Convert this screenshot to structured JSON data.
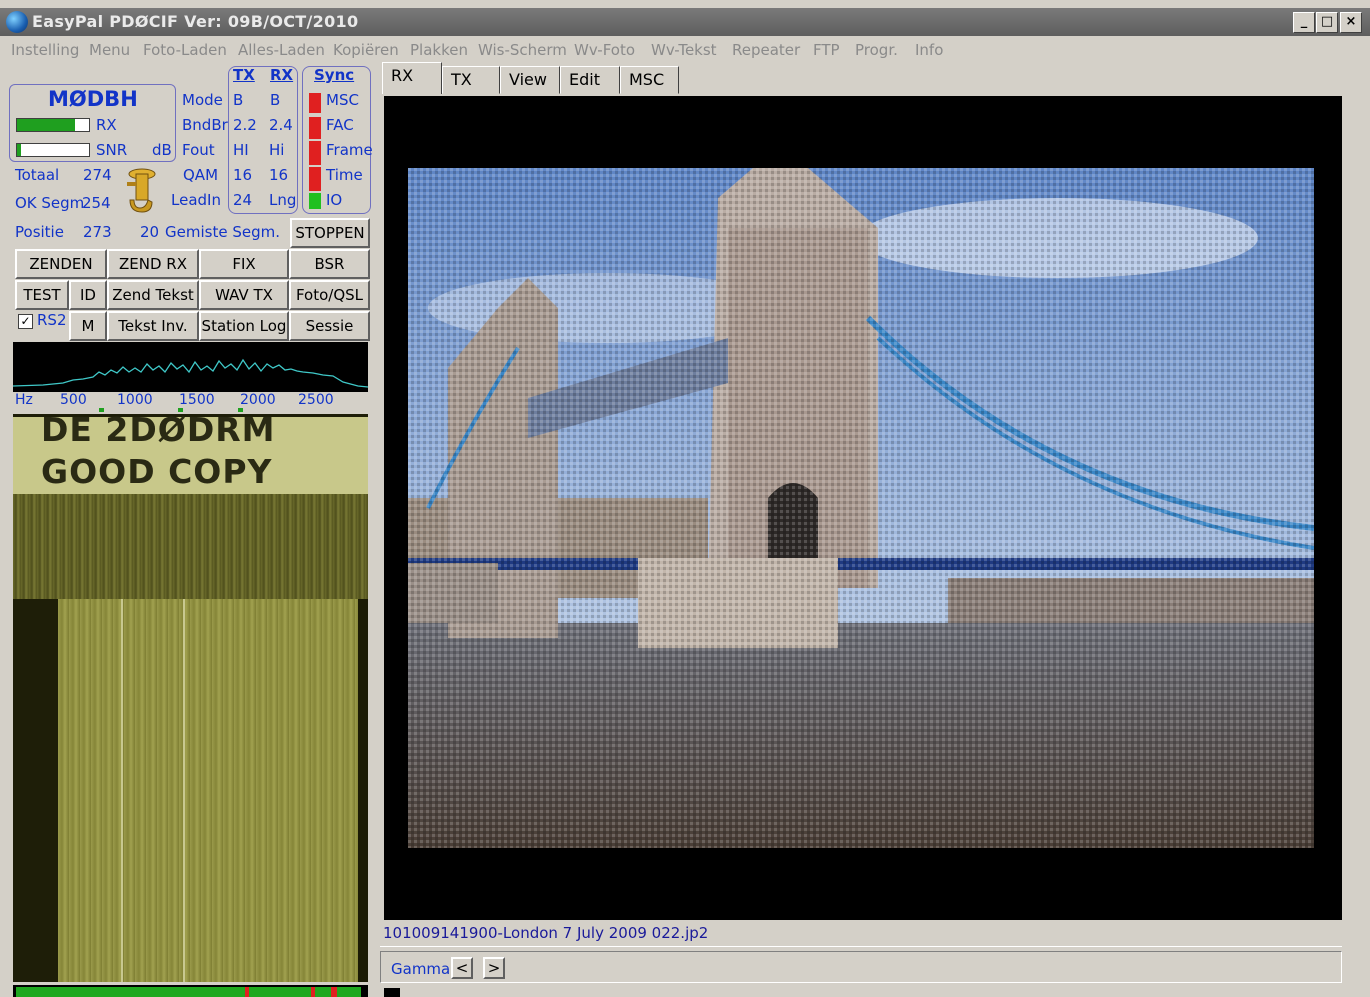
{
  "window": {
    "title": "EasyPal PDØCIF  Ver: 09B/OCT/2010"
  },
  "menu": [
    "Instelling",
    "Menu",
    "Foto-Laden",
    "Alles-Laden",
    "Kopiëren",
    "Plakken",
    "Wis-Scherm",
    "Wv-Foto",
    "Wv-Tekst",
    "Repeater",
    "FTP",
    "Progr.",
    "Info"
  ],
  "status": {
    "callsign": "MØDBH",
    "rx_label": "RX",
    "snr_label": "SNR",
    "db_label": "dB",
    "rx_level": 0.8,
    "snr_level": 0.06,
    "totaal_label": "Totaal",
    "totaal_value": "274",
    "ok_segm_label": "OK Segm",
    "ok_segm_value": "254",
    "positie_label": "Positie",
    "positie_value": "273",
    "gemiste_value": "20",
    "gemiste_label": "Gemiste Segm."
  },
  "params": {
    "tx_header": "TX",
    "rx_header": "RX",
    "rows": [
      {
        "label": "Mode",
        "tx": "B",
        "rx": "B"
      },
      {
        "label": "BndBr",
        "tx": "2.2",
        "rx": "2.4"
      },
      {
        "label": "Fout",
        "tx": "HI",
        "rx": "Hi"
      },
      {
        "label": "QAM",
        "tx": "16",
        "rx": "16"
      },
      {
        "label": "LeadIn",
        "tx": "24",
        "rx": "Lng"
      }
    ]
  },
  "sync": {
    "header": "Sync",
    "items": [
      {
        "label": "MSC",
        "color": "#e02020"
      },
      {
        "label": "FAC",
        "color": "#e02020"
      },
      {
        "label": "Frame",
        "color": "#e02020"
      },
      {
        "label": "Time",
        "color": "#e02020"
      },
      {
        "label": "IO",
        "color": "#20c020"
      }
    ]
  },
  "buttons": {
    "stoppen": "STOPPEN",
    "zenden": "ZENDEN",
    "zend_rx": "ZEND RX",
    "fix": "FIX",
    "bsr": "BSR",
    "test": "TEST",
    "id": "ID",
    "zend_tekst": "Zend Tekst",
    "wav_tx": "WAV TX",
    "foto_qsl": "Foto/QSL",
    "rs2": "RS2",
    "m": "M",
    "tekst_inv": "Tekst Inv.",
    "station_log": "Station Log",
    "sessie": "Sessie"
  },
  "rs2_checked": true,
  "spectrum": {
    "unit": "Hz",
    "ticks": [
      "500",
      "1000",
      "1500",
      "2000",
      "2500"
    ]
  },
  "waterfall": {
    "line1": "DE 2DØDRM",
    "line2": "GOOD COPY"
  },
  "tabs": [
    "RX",
    "TX",
    "View",
    "Edit",
    "MSC"
  ],
  "active_tab": "RX",
  "filename": "101009141900-London 7 July 2009 022.jp2",
  "gamma": {
    "label": "Gamma",
    "prev": "<",
    "next": ">"
  },
  "colors": {
    "accent_blue": "#1234c8",
    "bar_green": "#1f9f1f"
  }
}
